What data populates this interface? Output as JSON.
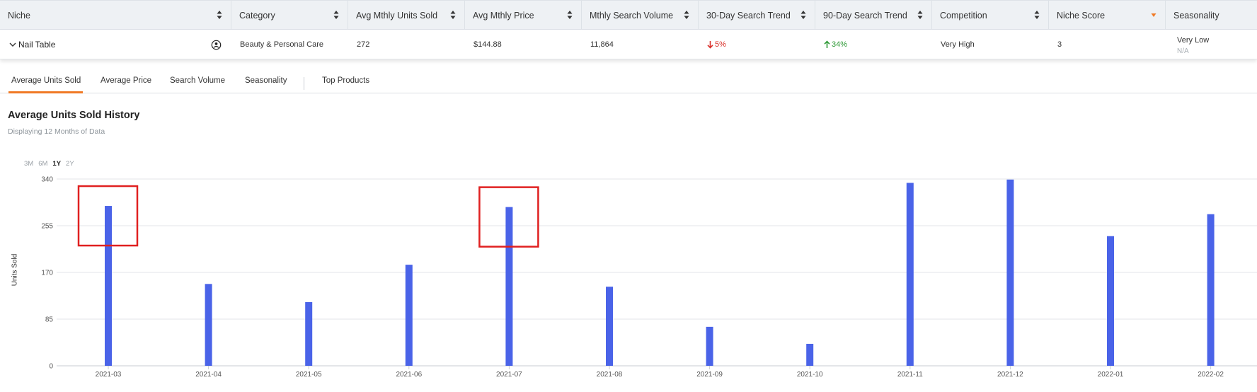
{
  "table": {
    "columns": [
      {
        "label": "Niche",
        "sort": "updown"
      },
      {
        "label": "Category",
        "sort": "updown"
      },
      {
        "label": "Avg Mthly Units Sold",
        "sort": "updown"
      },
      {
        "label": "Avg Mthly Price",
        "sort": "updown"
      },
      {
        "label": "Mthly Search Volume",
        "sort": "updown"
      },
      {
        "label": "30-Day Search Trend",
        "sort": "updown"
      },
      {
        "label": "90-Day Search Trend",
        "sort": "updown"
      },
      {
        "label": "Competition",
        "sort": "updown"
      },
      {
        "label": "Niche Score",
        "sort": "desc-active"
      },
      {
        "label": "Seasonality",
        "sort": "none"
      }
    ],
    "row": {
      "niche": "Nail Table",
      "category": "Beauty & Personal Care",
      "avg_units": "272",
      "avg_price": "$144.88",
      "search_volume": "11,864",
      "trend_30": "5%",
      "trend_30_dir": "down",
      "trend_90": "34%",
      "trend_90_dir": "up",
      "competition": "Very High",
      "niche_score": "3",
      "seasonality": "Very Low",
      "seasonality_sub": "N/A"
    }
  },
  "tabs": [
    {
      "label": "Average Units Sold",
      "active": true
    },
    {
      "label": "Average Price",
      "active": false
    },
    {
      "label": "Search Volume",
      "active": false
    },
    {
      "label": "Seasonality",
      "active": false
    },
    {
      "label": "Top Products",
      "active": false
    }
  ],
  "chart_header": {
    "title": "Average Units Sold History",
    "subtitle": "Displaying 12 Months of Data"
  },
  "range_options": [
    {
      "label": "3M",
      "active": false
    },
    {
      "label": "6M",
      "active": false
    },
    {
      "label": "1Y",
      "active": true
    },
    {
      "label": "2Y",
      "active": false
    }
  ],
  "colors": {
    "bar": "#4a63e8",
    "highlight_box": "#e02020",
    "accent": "#f07a25",
    "trend_down": "#d9302a",
    "trend_up": "#2f9a37"
  },
  "chart_data": {
    "type": "bar",
    "ylabel": "Units Sold",
    "xlabel": "",
    "ylim": [
      0,
      340
    ],
    "yticks": [
      0,
      85,
      170,
      255,
      340
    ],
    "categories": [
      "2021-03",
      "2021-04",
      "2021-05",
      "2021-06",
      "2021-07",
      "2021-08",
      "2021-09",
      "2021-10",
      "2021-11",
      "2021-12",
      "2022-01",
      "2022-02"
    ],
    "values": [
      291,
      149,
      116,
      184,
      289,
      144,
      71,
      40,
      333,
      339,
      236,
      276
    ],
    "grid": true,
    "highlighted_categories": [
      "2021-03",
      "2021-07"
    ]
  }
}
